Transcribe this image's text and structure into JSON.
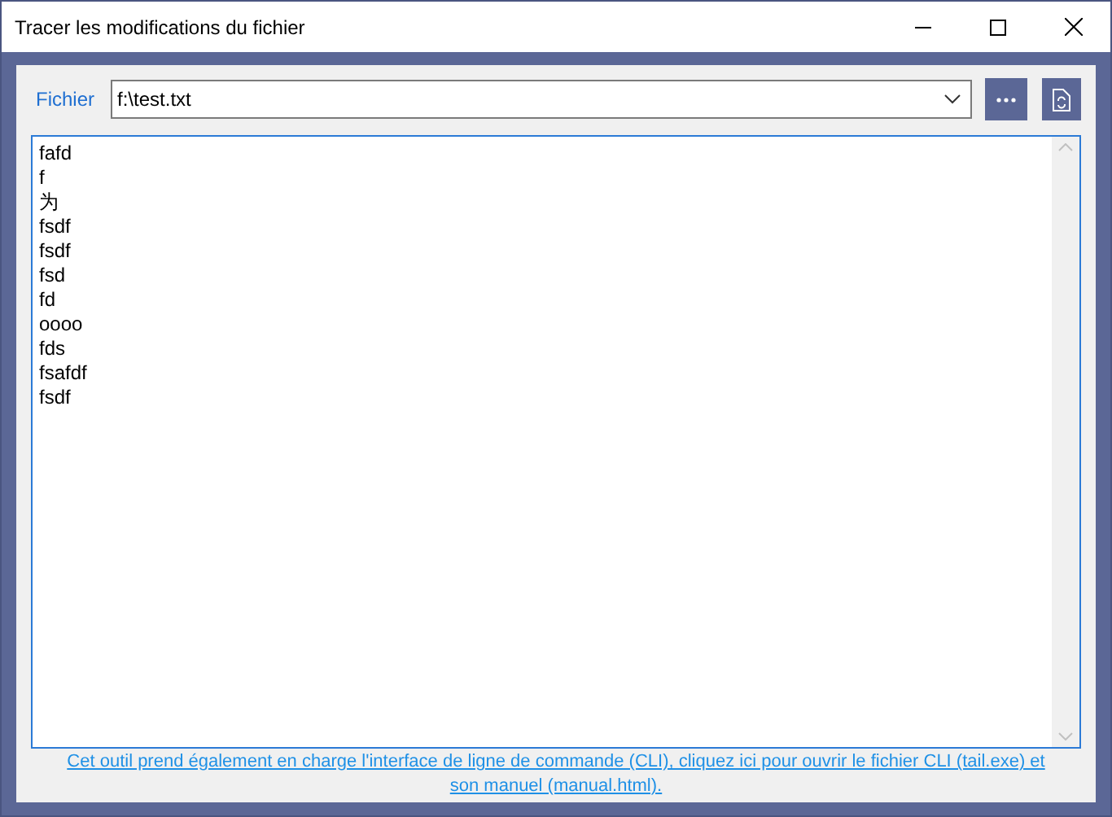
{
  "window": {
    "title": "Tracer les modifications du fichier"
  },
  "file": {
    "label": "Fichier",
    "value": "f:\\test.txt"
  },
  "content": {
    "lines": [
      "fafd",
      "f",
      "为",
      "fsdf",
      "fsdf",
      "fsd",
      "fd",
      "oooo",
      "fds",
      "fsafdf",
      "fsdf"
    ]
  },
  "footer_link": "Cet outil prend également en charge l'interface de ligne de commande (CLI), cliquez ici pour ouvrir le fichier CLI (tail.exe) et son manuel (manual.html)."
}
